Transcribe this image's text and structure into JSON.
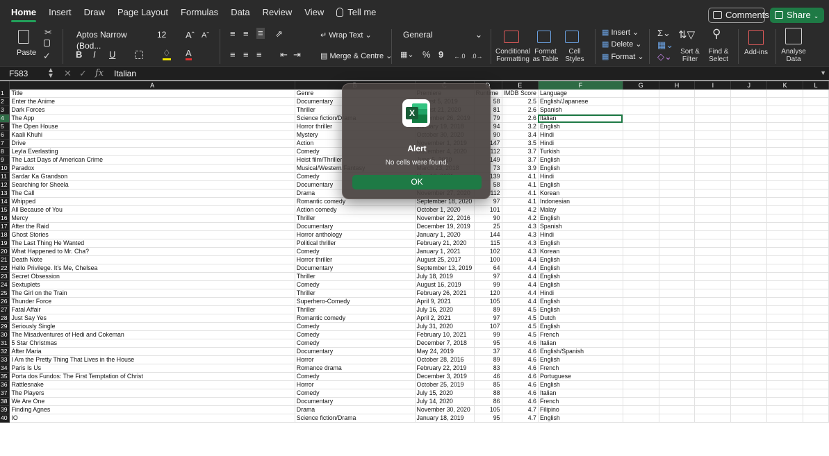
{
  "ribbon_tabs": [
    "Home",
    "Insert",
    "Draw",
    "Page Layout",
    "Formulas",
    "Data",
    "Review",
    "View",
    "Tell me"
  ],
  "header_buttons": {
    "comments": "Comments",
    "share": "Share"
  },
  "ribbon": {
    "paste": "Paste",
    "font_name": "Aptos Narrow (Bod...",
    "font_size": "12",
    "wrap_text": "Wrap Text",
    "merge_centre": "Merge & Centre",
    "number_format": "General",
    "conditional_formatting": [
      "Conditional",
      "Formatting"
    ],
    "format_as_table": [
      "Format",
      "as Table"
    ],
    "cell_styles": [
      "Cell",
      "Styles"
    ],
    "insert": "Insert",
    "delete": "Delete",
    "format": "Format",
    "sort_filter": [
      "Sort &",
      "Filter"
    ],
    "find_select": [
      "Find &",
      "Select"
    ],
    "add_ins": "Add-ins",
    "analyse_data": [
      "Analyse",
      "Data"
    ],
    "bold": "B",
    "italic": "I",
    "underline": "U",
    "percent": "%",
    "comma": "9"
  },
  "formula_bar": {
    "name_box": "F583",
    "fx": "fx",
    "value": "Italian"
  },
  "columns": [
    "A",
    "B",
    "C",
    "D",
    "E",
    "F",
    "G",
    "H",
    "I",
    "J",
    "K",
    "L"
  ],
  "selected_column": "F",
  "selected_row": "4",
  "rows": [
    {
      "n": "1",
      "a": "Title",
      "b": "Genre",
      "c": "Premiere",
      "d": "Runtime",
      "e": "IMDB Score",
      "f": "Language"
    },
    {
      "n": "2",
      "a": "Enter the Anime",
      "b": "Documentary",
      "c": "August 5, 2019",
      "d": "58",
      "e": "2.5",
      "f": "English/Japanese"
    },
    {
      "n": "3",
      "a": "Dark Forces",
      "b": "Thriller",
      "c": "August 21, 2020",
      "d": "81",
      "e": "2.6",
      "f": "Spanish"
    },
    {
      "n": "4",
      "a": "The App",
      "b": "Science fiction/Drama",
      "c": "December 26, 2019",
      "d": "79",
      "e": "2.6",
      "f": "Italian"
    },
    {
      "n": "5",
      "a": "The Open House",
      "b": "Horror thriller",
      "c": "January 19, 2018",
      "d": "94",
      "e": "3.2",
      "f": "English"
    },
    {
      "n": "6",
      "a": "Kaali Khuhi",
      "b": "Mystery",
      "c": "October 30, 2020",
      "d": "90",
      "e": "3.4",
      "f": "Hindi"
    },
    {
      "n": "7",
      "a": "Drive",
      "b": "Action",
      "c": "November 1, 2019",
      "d": "147",
      "e": "3.5",
      "f": "Hindi"
    },
    {
      "n": "8",
      "a": "Leyla Everlasting",
      "b": "Comedy",
      "c": "December 4, 2020",
      "d": "112",
      "e": "3.7",
      "f": "Turkish"
    },
    {
      "n": "9",
      "a": "The Last Days of American Crime",
      "b": "Heist film/Thriller",
      "c": "June 5, 2020",
      "d": "149",
      "e": "3.7",
      "f": "English"
    },
    {
      "n": "10",
      "a": "Paradox",
      "b": "Musical/Western/Fantasy",
      "c": "March 23, 2018",
      "d": "73",
      "e": "3.9",
      "f": "English"
    },
    {
      "n": "11",
      "a": "Sardar Ka Grandson",
      "b": "Comedy",
      "c": "May 18, 2021",
      "d": "139",
      "e": "4.1",
      "f": "Hindi"
    },
    {
      "n": "12",
      "a": "Searching for Sheela",
      "b": "Documentary",
      "c": "April 22, 2021",
      "d": "58",
      "e": "4.1",
      "f": "English"
    },
    {
      "n": "13",
      "a": "The Call",
      "b": "Drama",
      "c": "November 27, 2020",
      "d": "112",
      "e": "4.1",
      "f": "Korean"
    },
    {
      "n": "14",
      "a": "Whipped",
      "b": "Romantic comedy",
      "c": "September 18, 2020",
      "d": "97",
      "e": "4.1",
      "f": "Indonesian"
    },
    {
      "n": "15",
      "a": "All Because of You",
      "b": "Action comedy",
      "c": "October 1, 2020",
      "d": "101",
      "e": "4.2",
      "f": "Malay"
    },
    {
      "n": "16",
      "a": "Mercy",
      "b": "Thriller",
      "c": "November 22, 2016",
      "d": "90",
      "e": "4.2",
      "f": "English"
    },
    {
      "n": "17",
      "a": "After the Raid",
      "b": "Documentary",
      "c": "December 19, 2019",
      "d": "25",
      "e": "4.3",
      "f": "Spanish"
    },
    {
      "n": "18",
      "a": "Ghost Stories",
      "b": "Horror anthology",
      "c": "January 1, 2020",
      "d": "144",
      "e": "4.3",
      "f": "Hindi"
    },
    {
      "n": "19",
      "a": "The Last Thing He Wanted",
      "b": "Political thriller",
      "c": "February 21, 2020",
      "d": "115",
      "e": "4.3",
      "f": "English"
    },
    {
      "n": "20",
      "a": "What Happened to Mr. Cha?",
      "b": "Comedy",
      "c": "January 1, 2021",
      "d": "102",
      "e": "4.3",
      "f": "Korean"
    },
    {
      "n": "21",
      "a": "Death Note",
      "b": "Horror thriller",
      "c": "August 25, 2017",
      "d": "100",
      "e": "4.4",
      "f": "English"
    },
    {
      "n": "22",
      "a": "Hello Privilege. It's Me, Chelsea",
      "b": "Documentary",
      "c": "September 13, 2019",
      "d": "64",
      "e": "4.4",
      "f": "English"
    },
    {
      "n": "23",
      "a": "Secret Obsession",
      "b": "Thriller",
      "c": "July 18, 2019",
      "d": "97",
      "e": "4.4",
      "f": "English"
    },
    {
      "n": "24",
      "a": "Sextuplets",
      "b": "Comedy",
      "c": "August 16, 2019",
      "d": "99",
      "e": "4.4",
      "f": "English"
    },
    {
      "n": "25",
      "a": "The Girl on the Train",
      "b": "Thriller",
      "c": "February 26, 2021",
      "d": "120",
      "e": "4.4",
      "f": "Hindi"
    },
    {
      "n": "26",
      "a": "Thunder Force",
      "b": "Superhero-Comedy",
      "c": "April 9, 2021",
      "d": "105",
      "e": "4.4",
      "f": "English"
    },
    {
      "n": "27",
      "a": "Fatal Affair",
      "b": "Thriller",
      "c": "July 16, 2020",
      "d": "89",
      "e": "4.5",
      "f": "English"
    },
    {
      "n": "28",
      "a": "Just Say Yes",
      "b": "Romantic comedy",
      "c": "April 2, 2021",
      "d": "97",
      "e": "4.5",
      "f": "Dutch"
    },
    {
      "n": "29",
      "a": "Seriously Single",
      "b": "Comedy",
      "c": "July 31, 2020",
      "d": "107",
      "e": "4.5",
      "f": "English"
    },
    {
      "n": "30",
      "a": "The Misadventures of Hedi and Cokeman",
      "b": "Comedy",
      "c": "February 10, 2021",
      "d": "99",
      "e": "4.5",
      "f": "French"
    },
    {
      "n": "31",
      "a": "5 Star Christmas",
      "b": "Comedy",
      "c": "December 7, 2018",
      "d": "95",
      "e": "4.6",
      "f": "Italian"
    },
    {
      "n": "32",
      "a": "After Maria",
      "b": "Documentary",
      "c": "May 24, 2019",
      "d": "37",
      "e": "4.6",
      "f": "English/Spanish"
    },
    {
      "n": "33",
      "a": "I Am the Pretty Thing That Lives in the House",
      "b": "Horror",
      "c": "October 28, 2016",
      "d": "89",
      "e": "4.6",
      "f": "English"
    },
    {
      "n": "34",
      "a": "Paris Is Us",
      "b": "Romance drama",
      "c": "February 22, 2019",
      "d": "83",
      "e": "4.6",
      "f": "French"
    },
    {
      "n": "35",
      "a": "Porta dos Fundos: The First Temptation of Christ",
      "b": "Comedy",
      "c": "December 3, 2019",
      "d": "46",
      "e": "4.6",
      "f": "Portuguese"
    },
    {
      "n": "36",
      "a": "Rattlesnake",
      "b": "Horror",
      "c": "October 25, 2019",
      "d": "85",
      "e": "4.6",
      "f": "English"
    },
    {
      "n": "37",
      "a": "The Players",
      "b": "Comedy",
      "c": "July 15, 2020",
      "d": "88",
      "e": "4.6",
      "f": "Italian"
    },
    {
      "n": "38",
      "a": "We Are One",
      "b": "Documentary",
      "c": "July 14, 2020",
      "d": "86",
      "e": "4.6",
      "f": "French"
    },
    {
      "n": "39",
      "a": "Finding Agnes",
      "b": "Drama",
      "c": "November 30, 2020",
      "d": "105",
      "e": "4.7",
      "f": "Filipino"
    },
    {
      "n": "40",
      "a": "IO",
      "b": "Science fiction/Drama",
      "c": "January 18, 2019",
      "d": "95",
      "e": "4.7",
      "f": "English"
    }
  ],
  "dialog": {
    "title": "Alert",
    "message": "No cells were found.",
    "ok": "OK"
  },
  "colors": {
    "accent": "#1e7a45",
    "ribbon_bg": "#2b2b2b"
  }
}
